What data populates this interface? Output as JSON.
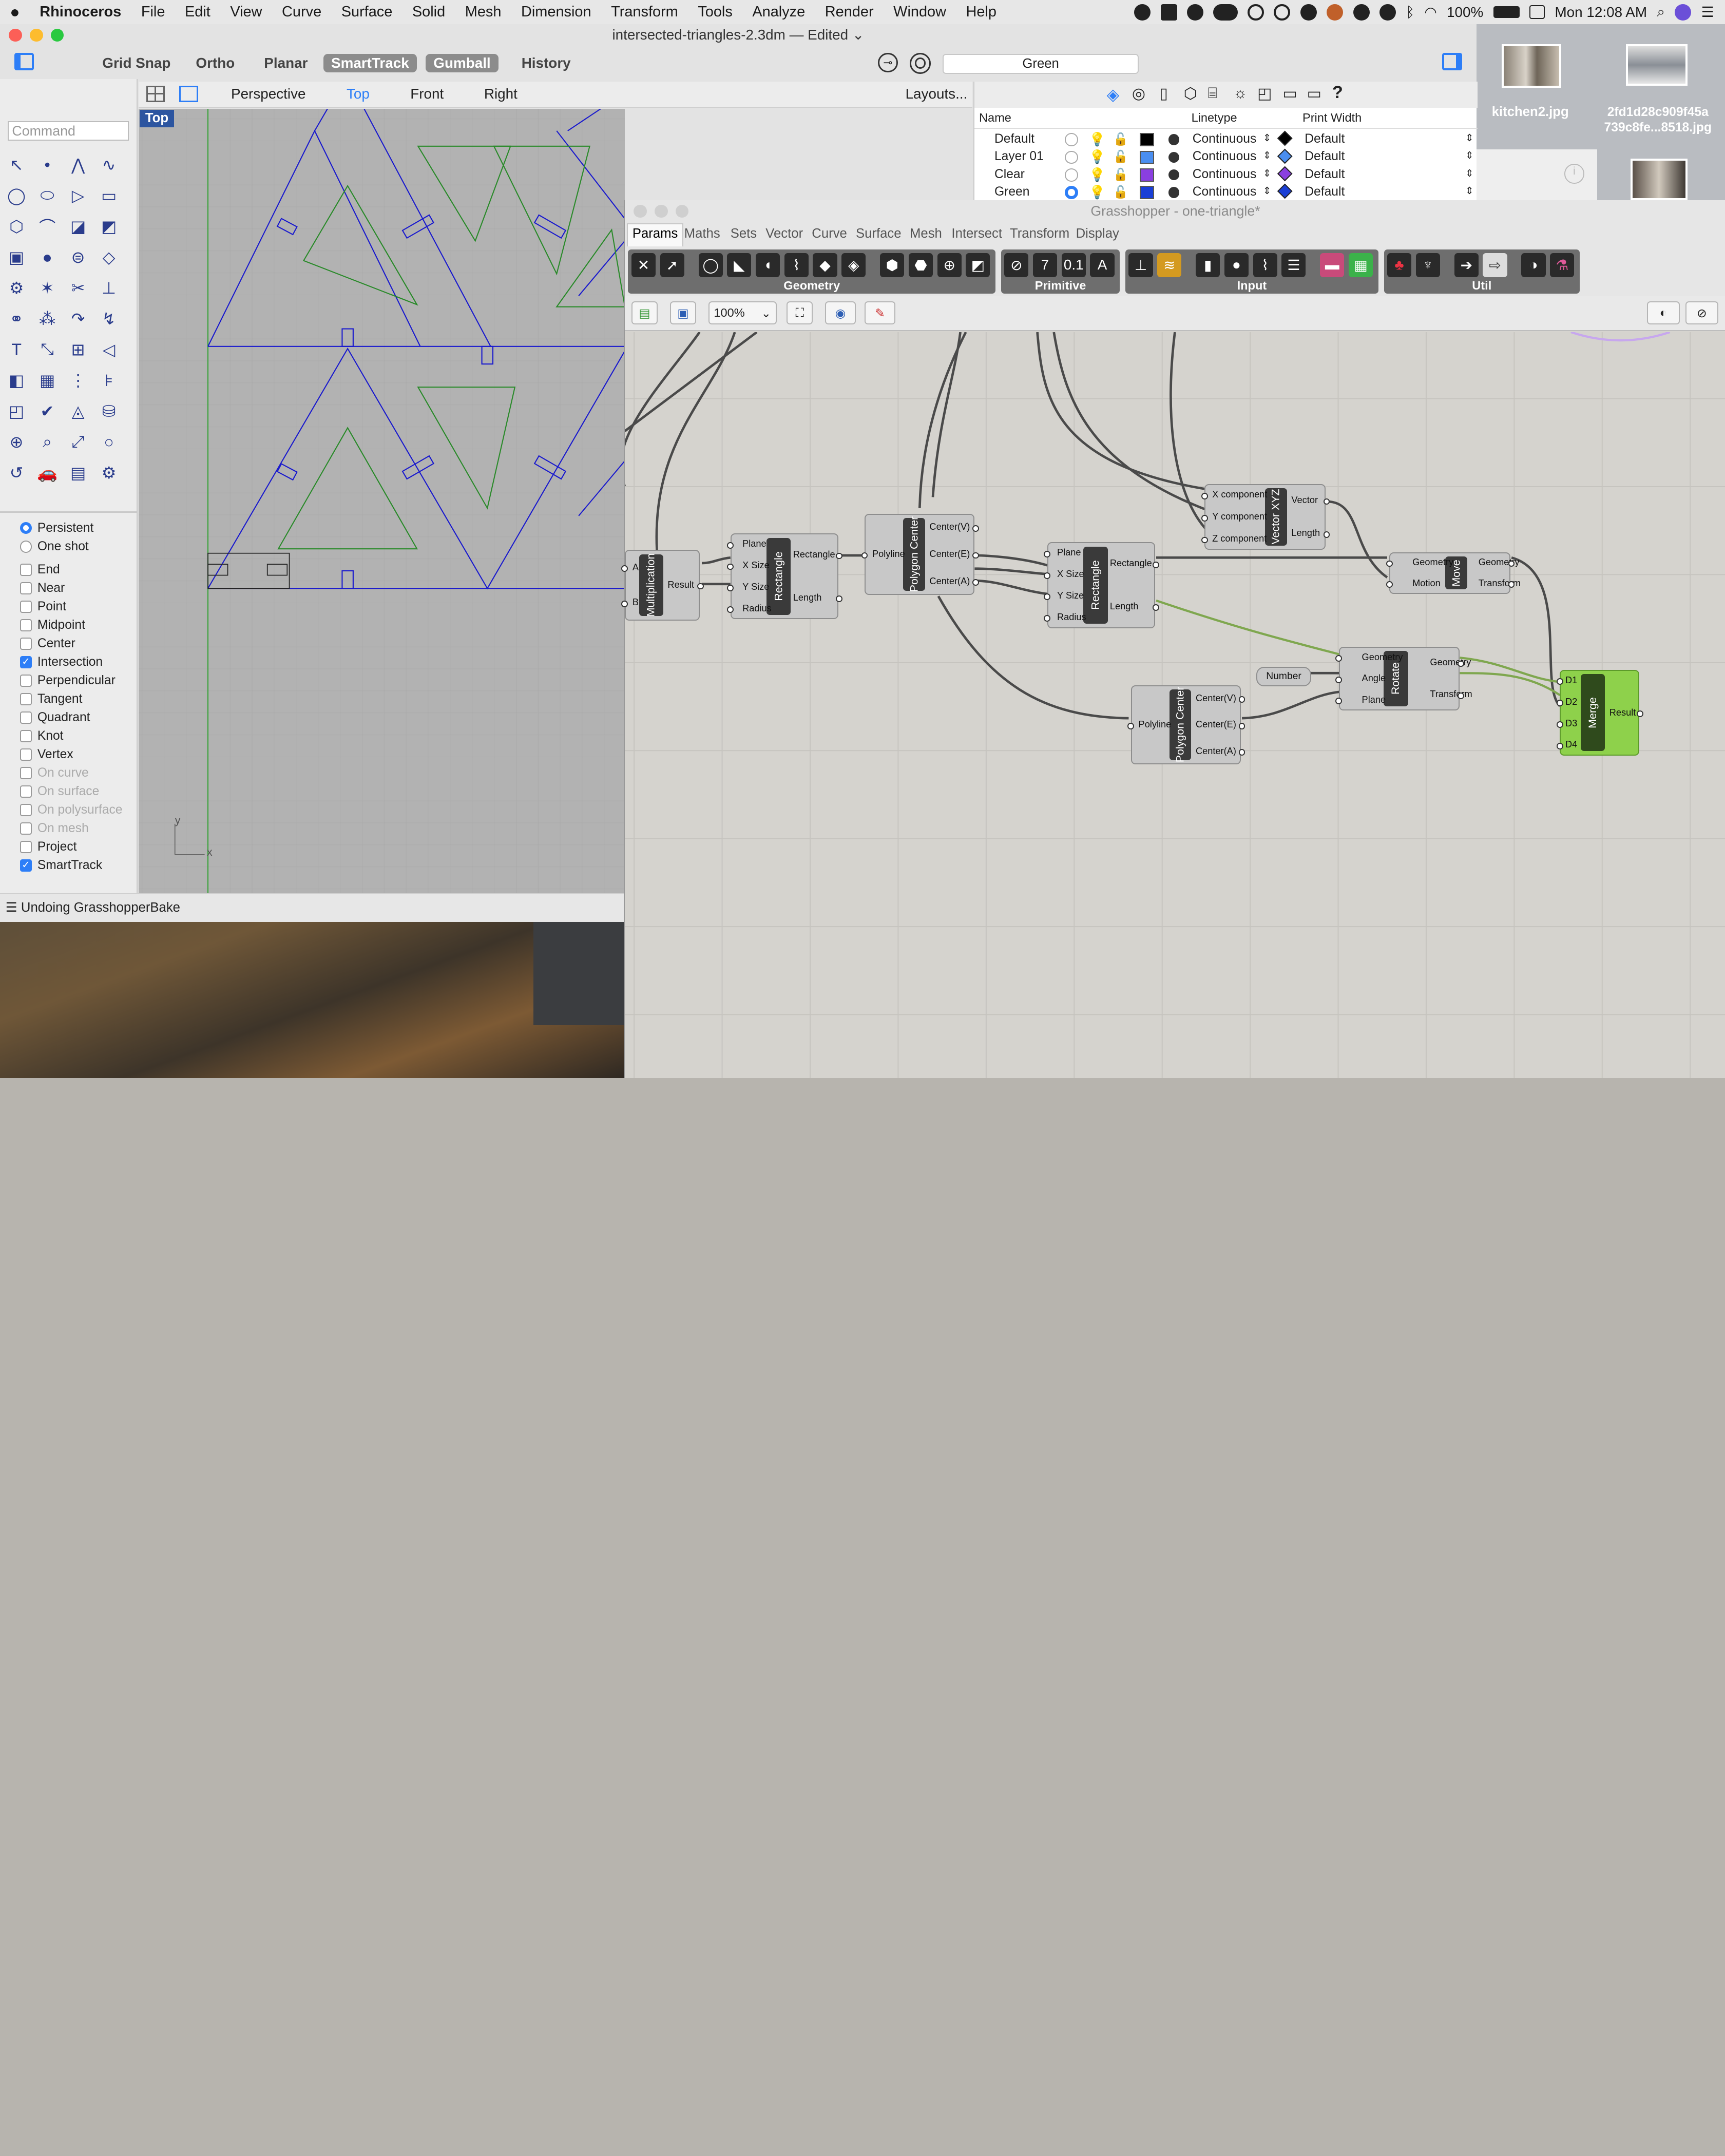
{
  "menubar": {
    "apple": "",
    "items": [
      "Rhinoceros",
      "File",
      "Edit",
      "View",
      "Curve",
      "Surface",
      "Solid",
      "Mesh",
      "Dimension",
      "Transform",
      "Tools",
      "Analyze",
      "Render",
      "Window",
      "Help"
    ],
    "battery": "100%",
    "clock": "Mon 12:08 AM"
  },
  "rhino": {
    "title": "intersected-triangles-2.3dm — Edited",
    "toolbar": {
      "grid_snap": "Grid Snap",
      "ortho": "Ortho",
      "planar": "Planar",
      "smarttrack": "SmartTrack",
      "gumball": "Gumball",
      "history": "History"
    },
    "current_layer": "Green",
    "viewtabs": {
      "perspective": "Perspective",
      "top": "Top",
      "front": "Front",
      "right": "Right",
      "layouts": "Layouts..."
    },
    "viewport_label": "Top",
    "axis_x": "x",
    "axis_y": "y",
    "command_placeholder": "Command",
    "status": "Undoing GrasshopperBake",
    "osnap": {
      "persistent": "Persistent",
      "one_shot": "One shot",
      "items": [
        {
          "label": "End",
          "checked": false,
          "enabled": true
        },
        {
          "label": "Near",
          "checked": false,
          "enabled": true
        },
        {
          "label": "Point",
          "checked": false,
          "enabled": true
        },
        {
          "label": "Midpoint",
          "checked": false,
          "enabled": true
        },
        {
          "label": "Center",
          "checked": false,
          "enabled": true
        },
        {
          "label": "Intersection",
          "checked": true,
          "enabled": true
        },
        {
          "label": "Perpendicular",
          "checked": false,
          "enabled": true
        },
        {
          "label": "Tangent",
          "checked": false,
          "enabled": true
        },
        {
          "label": "Quadrant",
          "checked": false,
          "enabled": true
        },
        {
          "label": "Knot",
          "checked": false,
          "enabled": true
        },
        {
          "label": "Vertex",
          "checked": false,
          "enabled": true
        },
        {
          "label": "On curve",
          "checked": false,
          "enabled": false
        },
        {
          "label": "On surface",
          "checked": false,
          "enabled": false
        },
        {
          "label": "On polysurface",
          "checked": false,
          "enabled": false
        },
        {
          "label": "On mesh",
          "checked": false,
          "enabled": false
        },
        {
          "label": "Project",
          "checked": false,
          "enabled": true
        },
        {
          "label": "SmartTrack",
          "checked": true,
          "enabled": true
        }
      ]
    },
    "layers": {
      "headers": {
        "name": "Name",
        "linetype": "Linetype",
        "print_width": "Print Width"
      },
      "rows": [
        {
          "name": "Default",
          "color": "#000000",
          "linetype": "Continuous",
          "width": "Default"
        },
        {
          "name": "Layer 01",
          "color": "#4a8ef0",
          "linetype": "Continuous",
          "width": "Default"
        },
        {
          "name": "Clear",
          "color": "#8a3fe0",
          "linetype": "Continuous",
          "width": "Default"
        },
        {
          "name": "Green",
          "color": "#1a3fd6",
          "linetype": "Continuous",
          "width": "Default"
        }
      ]
    }
  },
  "desktop": {
    "file1": "kitchen2.jpg",
    "file2_line1": "2fd1d28c909f45a",
    "file2_line2": "739c8fe...8518.jpg"
  },
  "grasshopper": {
    "title": "Grasshopper - one-triangle*",
    "tabs": [
      "Params",
      "Maths",
      "Sets",
      "Vector",
      "Curve",
      "Surface",
      "Mesh",
      "Intersect",
      "Transform",
      "Display"
    ],
    "groups": [
      "Geometry",
      "Primitive",
      "Input",
      "Util"
    ],
    "zoom": "100%",
    "components": {
      "multiplication": {
        "name": "Multiplication",
        "in": [
          "A",
          "B"
        ],
        "out": [
          "Result"
        ]
      },
      "rectangle1": {
        "name": "Rectangle",
        "in": [
          "Plane",
          "X Size",
          "Y Size",
          "Radius"
        ],
        "out": [
          "Rectangle",
          "Length"
        ]
      },
      "polycenter1": {
        "name": "Polygon Center",
        "in": [
          "Polyline"
        ],
        "out": [
          "Center(V)",
          "Center(E)",
          "Center(A)"
        ]
      },
      "rectangle2": {
        "name": "Rectangle",
        "in": [
          "Plane",
          "X Size",
          "Y Size",
          "Radius"
        ],
        "out": [
          "Rectangle",
          "Length"
        ]
      },
      "vectorxyz": {
        "name": "Vector XYZ",
        "in": [
          "X component",
          "Y component",
          "Z component"
        ],
        "out": [
          "Vector",
          "Length"
        ]
      },
      "move": {
        "name": "Move",
        "in": [
          "Geometry",
          "Motion"
        ],
        "out": [
          "Geometry",
          "Transform"
        ]
      },
      "number": {
        "name": "Number"
      },
      "rotate": {
        "name": "Rotate",
        "in": [
          "Geometry",
          "Angle",
          "Plane"
        ],
        "out": [
          "Geometry",
          "Transform"
        ]
      },
      "polycenter2": {
        "name": "Polygon Center",
        "in": [
          "Polyline"
        ],
        "out": [
          "Center(V)",
          "Center(E)",
          "Center(A)"
        ]
      },
      "merge": {
        "name": "Merge",
        "in": [
          "D1",
          "D2",
          "D3",
          "D4"
        ],
        "out": [
          "Result"
        ]
      }
    }
  }
}
